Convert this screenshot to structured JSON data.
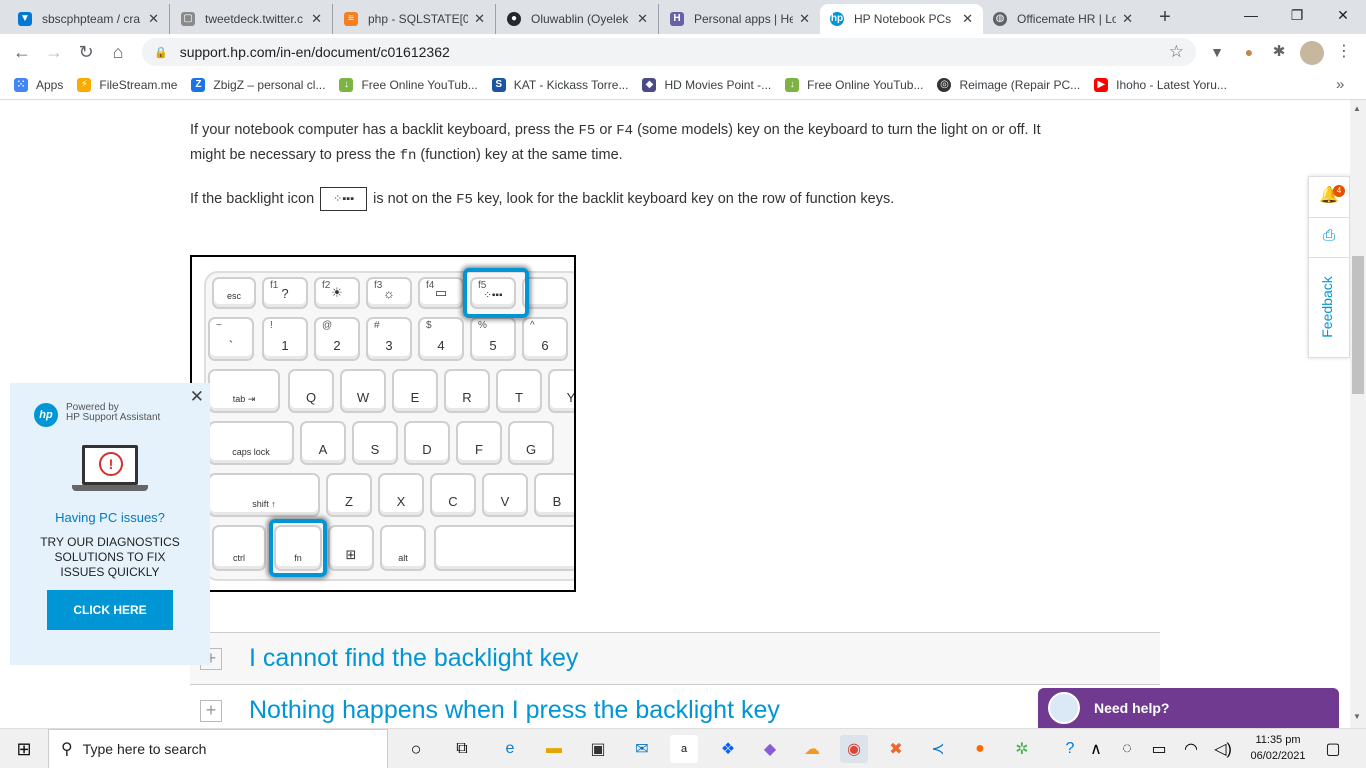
{
  "browser": {
    "tabs": [
      {
        "title": "sbscphpteam / cra",
        "icon": "azure-devops-icon",
        "color": "#0078d4"
      },
      {
        "title": "tweetdeck.twitter.c",
        "icon": "tweetdeck-icon",
        "color": "#8a8a8a"
      },
      {
        "title": "php - SQLSTATE[0(",
        "icon": "stackoverflow-icon",
        "color": "#f48024"
      },
      {
        "title": "Oluwablin (Oyelek",
        "icon": "github-icon",
        "color": "#24292e"
      },
      {
        "title": "Personal apps | He",
        "icon": "heroku-icon",
        "color": "#6762a6"
      },
      {
        "title": "HP Notebook PCs",
        "icon": "hp-icon",
        "color": "#0096d6"
      },
      {
        "title": "Officemate HR | Lo",
        "icon": "globe-icon",
        "color": "#5f6368"
      }
    ],
    "new_tab": "+",
    "url": "support.hp.com/in-en/document/c01612362",
    "bookmarks": [
      {
        "label": "Apps",
        "icon": "apps-grid-icon",
        "color": "#4285f4"
      },
      {
        "label": "FileStream.me",
        "icon": "filestream-icon",
        "color": "#f9ab00"
      },
      {
        "label": "ZbigZ – personal cl...",
        "icon": "zbigz-icon",
        "color": "#1a73e8"
      },
      {
        "label": "Free Online YouTub...",
        "icon": "download-arrow-icon",
        "color": "#7cb342"
      },
      {
        "label": "KAT - Kickass Torre...",
        "icon": "kat-icon",
        "color": "#1c54a1"
      },
      {
        "label": "HD Movies Point -...",
        "icon": "hdmovies-icon",
        "color": "#4a4a8a"
      },
      {
        "label": "Free Online YouTub...",
        "icon": "download-arrow-icon",
        "color": "#7cb342"
      },
      {
        "label": "Reimage (Repair PC...",
        "icon": "reimage-icon",
        "color": "#333333"
      },
      {
        "label": "Ihoho - Latest Yoru...",
        "icon": "youtube-icon",
        "color": "#ff0000"
      }
    ],
    "more_bookmarks": "»"
  },
  "content": {
    "para1_a": "If your notebook computer has a backlit keyboard, press the ",
    "key_f5": "F5",
    "para1_b": " or ",
    "key_f4": "F4",
    "para1_c": " (some models) key on the keyboard to turn the light on or off. It",
    "para1_d": "might be necessary to press the ",
    "key_fn": "fn",
    "para1_e": " (function) key at the same time.",
    "para2_a": "If the backlight icon ",
    "para2_icon": "⁘▪▪▪",
    "para2_b": " is not on the ",
    "para2_key": "F5",
    "para2_c": " key, look for the backlit keyboard key on the row of function keys.",
    "accordion": [
      {
        "label": "I cannot find the backlight key"
      },
      {
        "label": "Nothing happens when I press the backlight key"
      }
    ]
  },
  "keyboard": {
    "row_fn": [
      {
        "main": "esc",
        "sub": ""
      },
      {
        "main": "?",
        "sub": "f1"
      },
      {
        "main": "☀",
        "sub": "f2"
      },
      {
        "main": "☼",
        "sub": "f3"
      },
      {
        "main": "▭",
        "sub": "f4"
      },
      {
        "main": "⁘▪▪▪",
        "sub": "f5"
      }
    ],
    "row_num": [
      {
        "main": "`",
        "sub": "~"
      },
      {
        "main": "1",
        "sub": "!"
      },
      {
        "main": "2",
        "sub": "@"
      },
      {
        "main": "3",
        "sub": "#"
      },
      {
        "main": "4",
        "sub": "$"
      },
      {
        "main": "5",
        "sub": "%"
      },
      {
        "main": "6",
        "sub": "^"
      }
    ],
    "row_q": [
      {
        "main": "tab ⇥",
        "sub": ""
      },
      {
        "main": "Q"
      },
      {
        "main": "W"
      },
      {
        "main": "E"
      },
      {
        "main": "R"
      },
      {
        "main": "T"
      },
      {
        "main": "Y"
      }
    ],
    "row_a": [
      {
        "main": "caps lock"
      },
      {
        "main": "A"
      },
      {
        "main": "S"
      },
      {
        "main": "D"
      },
      {
        "main": "F"
      },
      {
        "main": "G"
      }
    ],
    "row_z": [
      {
        "main": "shift ↑"
      },
      {
        "main": "Z"
      },
      {
        "main": "X"
      },
      {
        "main": "C"
      },
      {
        "main": "V"
      },
      {
        "main": "B"
      }
    ],
    "row_bottom": [
      {
        "main": "ctrl"
      },
      {
        "main": "fn"
      },
      {
        "main": "⊞"
      },
      {
        "main": "alt"
      },
      {
        "main": ""
      }
    ]
  },
  "popup": {
    "powered_by": "Powered by",
    "assistant": "HP Support Assistant",
    "heading": "Having PC issues?",
    "body": "TRY OUR DIAGNOSTICS SOLUTIONS TO FIX ISSUES QUICKLY",
    "button": "CLICK HERE",
    "close": "✕"
  },
  "side_widget": {
    "notification_count": "4",
    "feedback": "Feedback"
  },
  "chat": {
    "label": "Need help?"
  },
  "taskbar": {
    "search_placeholder": "Type here to search",
    "time": "11:35 pm",
    "date": "06/02/2021"
  },
  "colors": {
    "hp_blue": "#0096d6",
    "chat_purple": "#6f3a8f"
  }
}
